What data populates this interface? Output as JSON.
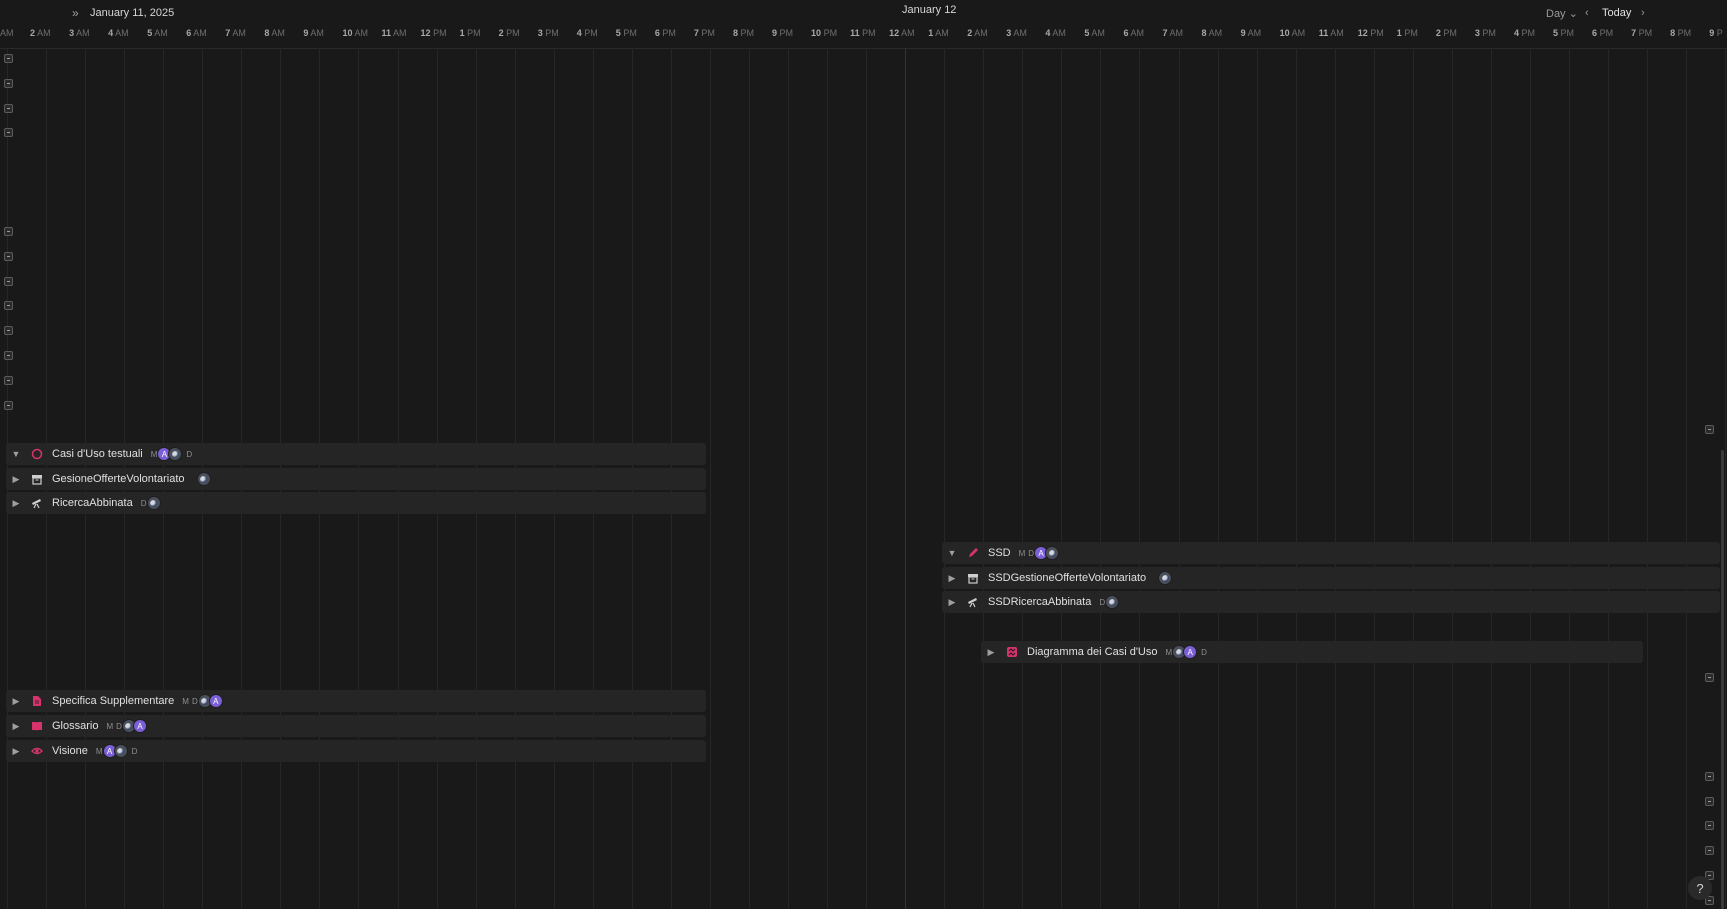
{
  "header": {
    "left_date": "January 11, 2025",
    "center_date": "January 12",
    "view_label": "Day",
    "today_label": "Today"
  },
  "ticks": [
    {
      "n": "",
      "s": "AM"
    },
    {
      "n": "2",
      "s": "AM"
    },
    {
      "n": "3",
      "s": "AM"
    },
    {
      "n": "4",
      "s": "AM"
    },
    {
      "n": "5",
      "s": "AM"
    },
    {
      "n": "6",
      "s": "AM"
    },
    {
      "n": "7",
      "s": "AM"
    },
    {
      "n": "8",
      "s": "AM"
    },
    {
      "n": "9",
      "s": "AM"
    },
    {
      "n": "10",
      "s": "AM"
    },
    {
      "n": "11",
      "s": "AM"
    },
    {
      "n": "12",
      "s": "PM"
    },
    {
      "n": "1",
      "s": "PM"
    },
    {
      "n": "2",
      "s": "PM"
    },
    {
      "n": "3",
      "s": "PM"
    },
    {
      "n": "4",
      "s": "PM"
    },
    {
      "n": "5",
      "s": "PM"
    },
    {
      "n": "6",
      "s": "PM"
    },
    {
      "n": "7",
      "s": "PM"
    },
    {
      "n": "8",
      "s": "PM"
    },
    {
      "n": "9",
      "s": "PM"
    },
    {
      "n": "10",
      "s": "PM"
    },
    {
      "n": "11",
      "s": "PM"
    },
    {
      "n": "12",
      "s": "AM"
    },
    {
      "n": "1",
      "s": "AM"
    },
    {
      "n": "2",
      "s": "AM"
    },
    {
      "n": "3",
      "s": "AM"
    },
    {
      "n": "4",
      "s": "AM"
    },
    {
      "n": "5",
      "s": "AM"
    },
    {
      "n": "6",
      "s": "AM"
    },
    {
      "n": "7",
      "s": "AM"
    },
    {
      "n": "8",
      "s": "AM"
    },
    {
      "n": "9",
      "s": "AM"
    },
    {
      "n": "10",
      "s": "AM"
    },
    {
      "n": "11",
      "s": "AM"
    },
    {
      "n": "12",
      "s": "PM"
    },
    {
      "n": "1",
      "s": "PM"
    },
    {
      "n": "2",
      "s": "PM"
    },
    {
      "n": "3",
      "s": "PM"
    },
    {
      "n": "4",
      "s": "PM"
    },
    {
      "n": "5",
      "s": "PM"
    },
    {
      "n": "6",
      "s": "PM"
    },
    {
      "n": "7",
      "s": "PM"
    },
    {
      "n": "8",
      "s": "PM"
    },
    {
      "n": "9",
      "s": "P"
    }
  ],
  "rows": {
    "casi": {
      "title": "Casi d'Uso testuali",
      "labels": [
        "M",
        "D"
      ],
      "icon": "circle-icon",
      "color": "#d6336c"
    },
    "gestione": {
      "title": "GesioneOfferteVolontariato",
      "icon": "archive-icon"
    },
    "ricerca": {
      "title": "RicercaAbbinata",
      "labels": [
        "D"
      ],
      "icon": "telescope-icon"
    },
    "ssd": {
      "title": "SSD",
      "labels": [
        "M",
        "D"
      ],
      "icon": "pen-icon",
      "color": "#d6336c"
    },
    "ssd_gestione": {
      "title": "SSDGestioneOfferteVolontariato",
      "icon": "archive-icon"
    },
    "ssd_ricerca": {
      "title": "SSDRicercaAbbinata",
      "labels": [
        "D"
      ],
      "icon": "telescope-icon"
    },
    "diagramma": {
      "title": "Diagramma dei Casi d'Uso",
      "labels": [
        "M",
        "D"
      ],
      "icon": "diagram-icon",
      "color": "#d6336c"
    },
    "specifica": {
      "title": "Specifica Supplementare",
      "labels": [
        "M",
        "D"
      ],
      "icon": "document-icon",
      "color": "#d6336c"
    },
    "glossario": {
      "title": "Glossario",
      "labels": [
        "M",
        "D"
      ],
      "icon": "book-icon",
      "color": "#d6336c"
    },
    "visione": {
      "title": "Visione",
      "labels": [
        "M",
        "D"
      ],
      "icon": "eye-icon",
      "color": "#d6336c"
    }
  },
  "avatar_initial": "A",
  "help_label": "?"
}
